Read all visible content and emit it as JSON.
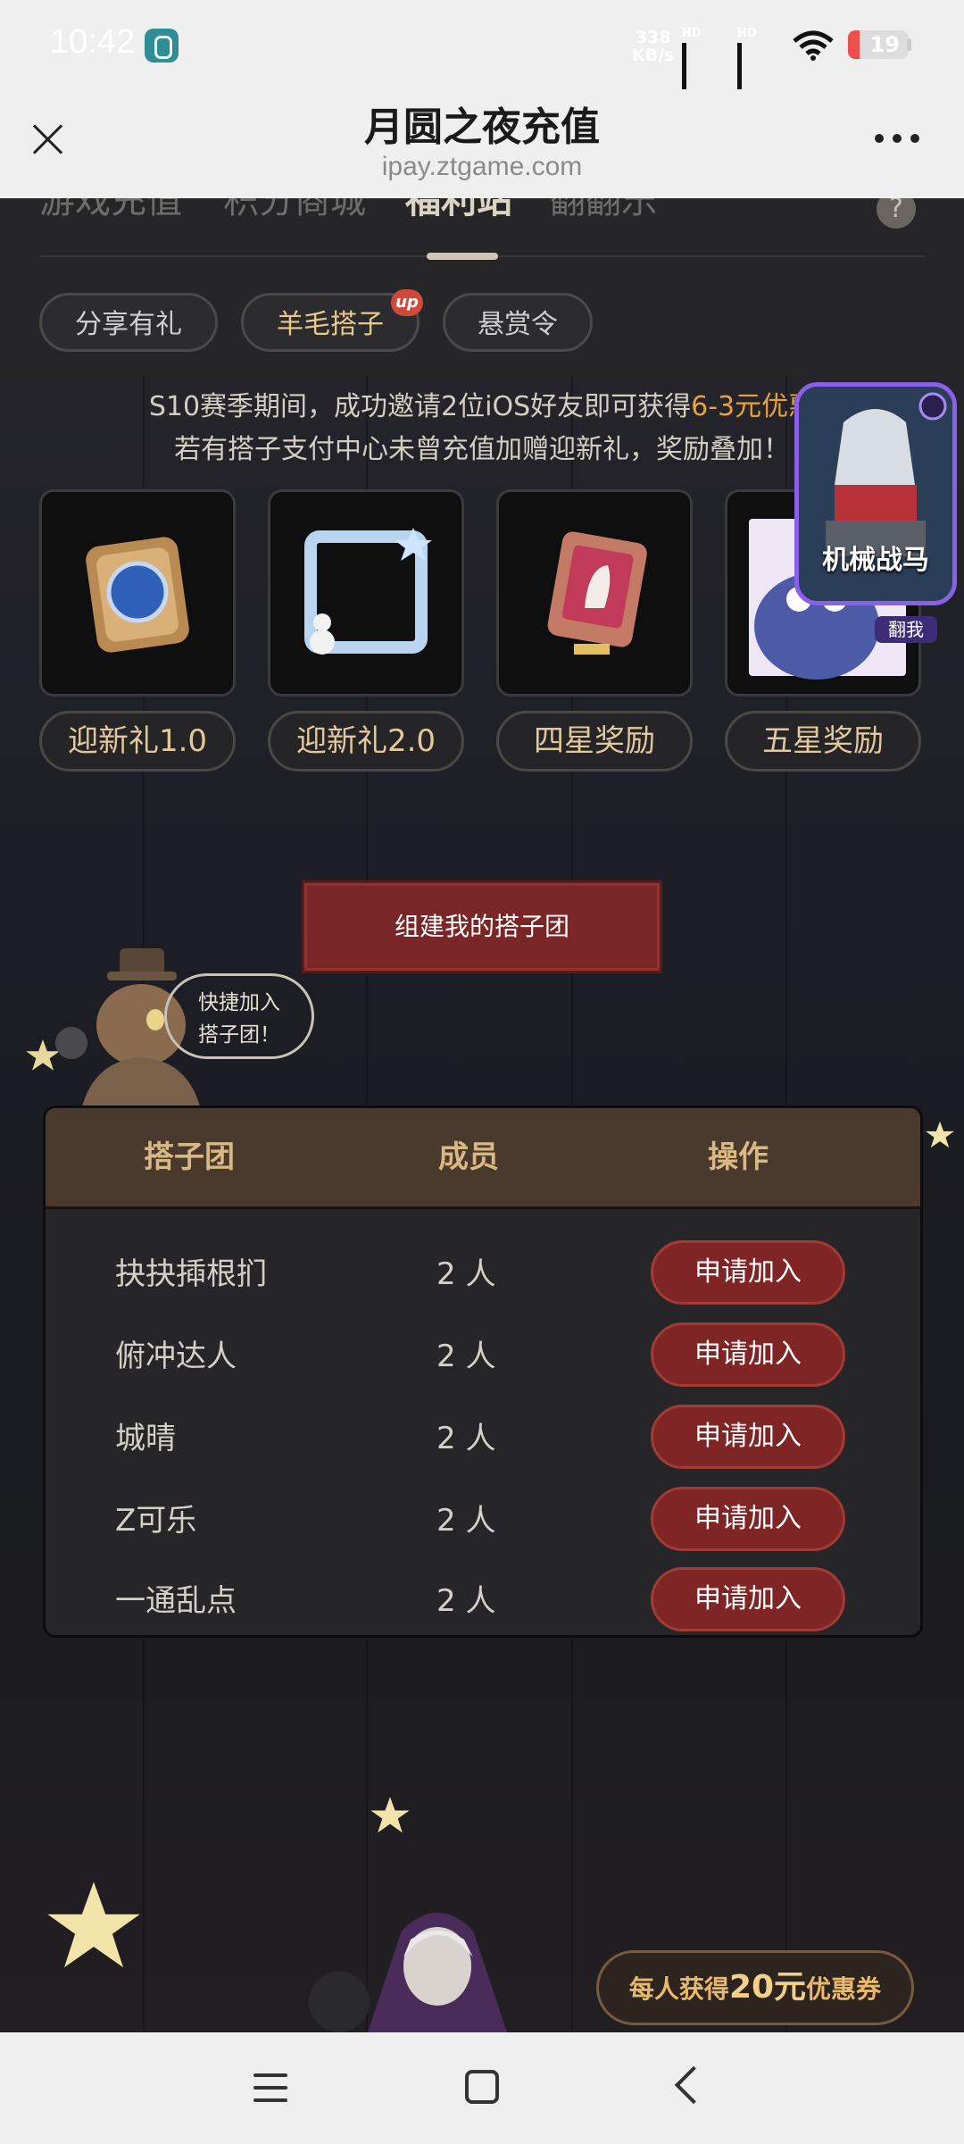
{
  "status_bar": {
    "time": "10:42",
    "net_speed_value": "338",
    "net_speed_unit": "KB/s",
    "signal1_label": "HD",
    "signal2_label": "HD",
    "battery_level": "19"
  },
  "browser": {
    "title": "月圆之夜充值",
    "url": "ipay.ztgame.com"
  },
  "tabs": [
    {
      "label": "游戏充值"
    },
    {
      "label": "积分商城"
    },
    {
      "label": "福利站"
    },
    {
      "label": "翻翻乐"
    }
  ],
  "help_label": "?",
  "sub_tabs": [
    {
      "label": "分享有礼"
    },
    {
      "label": "羊毛搭子"
    },
    {
      "label": "悬赏令"
    }
  ],
  "up_badge": "up",
  "info": {
    "line1_pre": "S10赛季期间，成功邀请2位iOS好友即可获得",
    "line1_highlight": "6-3元优惠",
    "line2": "若有搭子支付中心未曾充值加赠迎新礼，奖励叠加！"
  },
  "rewards": [
    {
      "label": "迎新礼1.0"
    },
    {
      "label": "迎新礼2.0"
    },
    {
      "label": "四星奖励"
    },
    {
      "label": "五星奖励"
    }
  ],
  "float_widget": {
    "label": "机械战马",
    "tag": "翻我"
  },
  "create_button": "组建我的搭子团",
  "bubble": {
    "line1": "快捷加入",
    "line2": "搭子团！"
  },
  "table": {
    "headers": [
      "搭子团",
      "成员",
      "操作"
    ],
    "rows": [
      {
        "name": "抉抉揷根扪",
        "count": "2 人",
        "action": "申请加入"
      },
      {
        "name": "俯冲达人",
        "count": "2 人",
        "action": "申请加入"
      },
      {
        "name": "城晴",
        "count": "2 人",
        "action": "申请加入"
      },
      {
        "name": "Z可乐",
        "count": "2 人",
        "action": "申请加入"
      },
      {
        "name": "一通乱点",
        "count": "2 人",
        "action": "申请加入"
      }
    ]
  },
  "coupon": {
    "pre": "每人获得",
    "amount": "20元",
    "post": "优惠券"
  },
  "colors": {
    "accent_gold": "#e2c89b",
    "highlight_orange": "#e8a23c",
    "button_red": "#7f2525",
    "widget_purple": "#8a60ea"
  }
}
